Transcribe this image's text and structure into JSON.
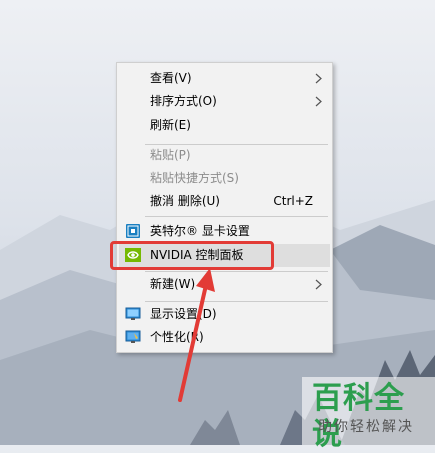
{
  "menu": {
    "items": [
      {
        "label": "查看(V)",
        "submenu": true
      },
      {
        "label": "排序方式(O)",
        "submenu": true
      },
      {
        "label": "刷新(E)"
      },
      {
        "label": "粘贴(P)",
        "disabled": true
      },
      {
        "label": "粘贴快捷方式(S)",
        "disabled": true
      },
      {
        "label": "撤消 删除(U)",
        "shortcut": "Ctrl+Z"
      },
      {
        "label": "英特尔® 显卡设置",
        "icon": "intel-graphics-icon"
      },
      {
        "label": "NVIDIA 控制面板",
        "icon": "nvidia-icon",
        "highlighted": true
      },
      {
        "label": "新建(W)",
        "submenu": true
      },
      {
        "label": "显示设置(D)",
        "icon": "display-settings-icon"
      },
      {
        "label": "个性化(R)",
        "icon": "personalize-icon"
      }
    ]
  },
  "watermark": {
    "title": "百科全说",
    "subtitle": "助你轻松解决"
  },
  "colors": {
    "annotation": "#e23b36",
    "brand_green": "#2c9e4e",
    "menu_bg": "#f2f2f2"
  }
}
